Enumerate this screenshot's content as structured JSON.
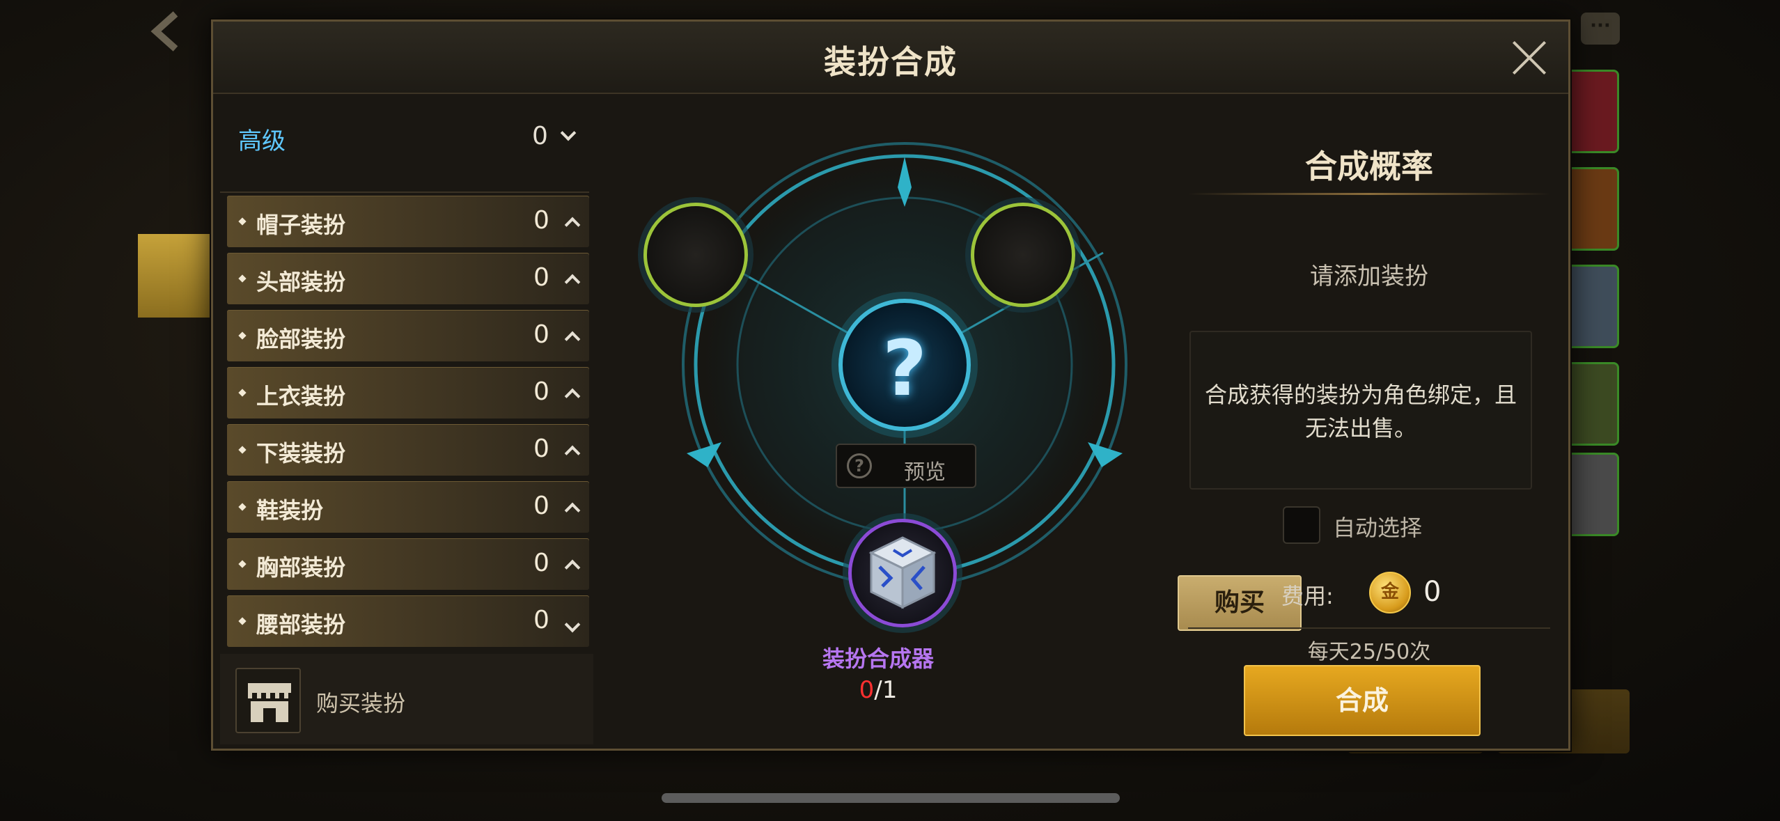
{
  "modal": {
    "title": "装扮合成"
  },
  "left": {
    "grade": {
      "label": "高级",
      "count": "0"
    },
    "categories": [
      {
        "label": "帽子装扮",
        "count": "0"
      },
      {
        "label": "头部装扮",
        "count": "0"
      },
      {
        "label": "脸部装扮",
        "count": "0"
      },
      {
        "label": "上衣装扮",
        "count": "0"
      },
      {
        "label": "下装装扮",
        "count": "0"
      },
      {
        "label": "鞋装扮",
        "count": "0"
      },
      {
        "label": "胸部装扮",
        "count": "0"
      },
      {
        "label": "腰部装扮",
        "count": "0"
      }
    ],
    "buy_outfit_label": "购买装扮"
  },
  "center": {
    "result_symbol": "?",
    "preview_icon": "?",
    "preview_label": "预览",
    "item_name": "装扮合成器",
    "qty_have": "0",
    "qty_sep": "/",
    "qty_need": "1",
    "buy_label": "购买"
  },
  "right": {
    "title": "合成概率",
    "add_prompt": "请添加装扮",
    "notice": "合成获得的装扮为角色绑定，且无法出售。",
    "auto_select_label": "自动选择",
    "cost_label": "费用:",
    "coin_glyph": "金",
    "cost_value": "0",
    "daily_limit": "每天25/50次",
    "synth_label": "合成"
  },
  "colors": {
    "accent_gold": "#e6a820",
    "grade_blue": "#5fc8ff",
    "item_purple": "#b676f0",
    "qty_red": "#ff3030",
    "slot_ring_green": "#9cc43a",
    "magic_circle_cyan": "#2fb2c8"
  },
  "icons": [
    "back-arrow-icon",
    "chat-icon",
    "close-icon",
    "chevron-down-icon",
    "chevron-up-icon",
    "shop-icon",
    "question-mark-icon",
    "synthesizer-cube-icon",
    "gold-coin-icon",
    "checkbox-icon"
  ]
}
